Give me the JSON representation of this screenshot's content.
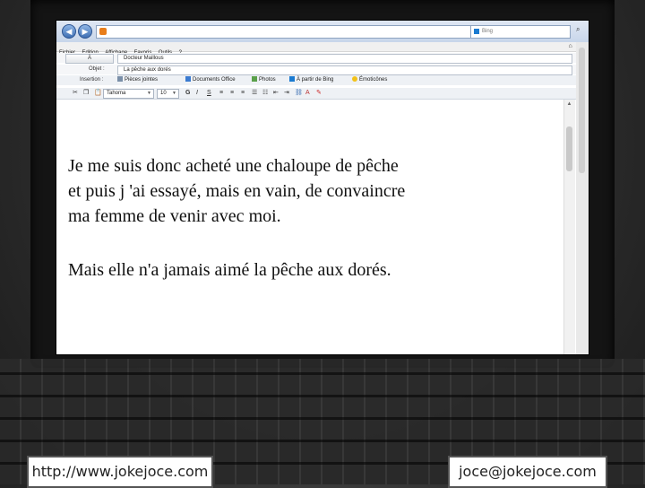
{
  "browser": {
    "search_placeholder": "Bing"
  },
  "menu": {
    "items": [
      "Fichier",
      "Edition",
      "Affichage",
      "Favoris",
      "Outils",
      "?"
    ]
  },
  "compose": {
    "to_button": "À",
    "to_value": "Docteur Maillous",
    "subject_label": "Objet :",
    "subject_value": "La pêche aux dorés",
    "insertion_label": "Insertion :",
    "insert_items": [
      "Pièces jointes",
      "Documents Office",
      "Photos",
      "À partir de Bing",
      "Émoticônes"
    ]
  },
  "format": {
    "font": "Tahoma",
    "size": "10",
    "bold": "G",
    "italic": "I",
    "underline": "S"
  },
  "message": {
    "paragraph1": "Je me suis donc acheté une chaloupe de pêche\net puis j 'ai essayé, mais en vain, de convaincre\nma femme de venir avec moi.",
    "paragraph2": "Mais elle n'a jamais aimé la pêche aux dorés."
  },
  "footer": {
    "website": "http://www.jokejoce.com",
    "email": "joce@jokejoce.com"
  },
  "colors": {
    "bezel": "#141414",
    "chrome": "#c8d6ea",
    "text": "#111111"
  }
}
